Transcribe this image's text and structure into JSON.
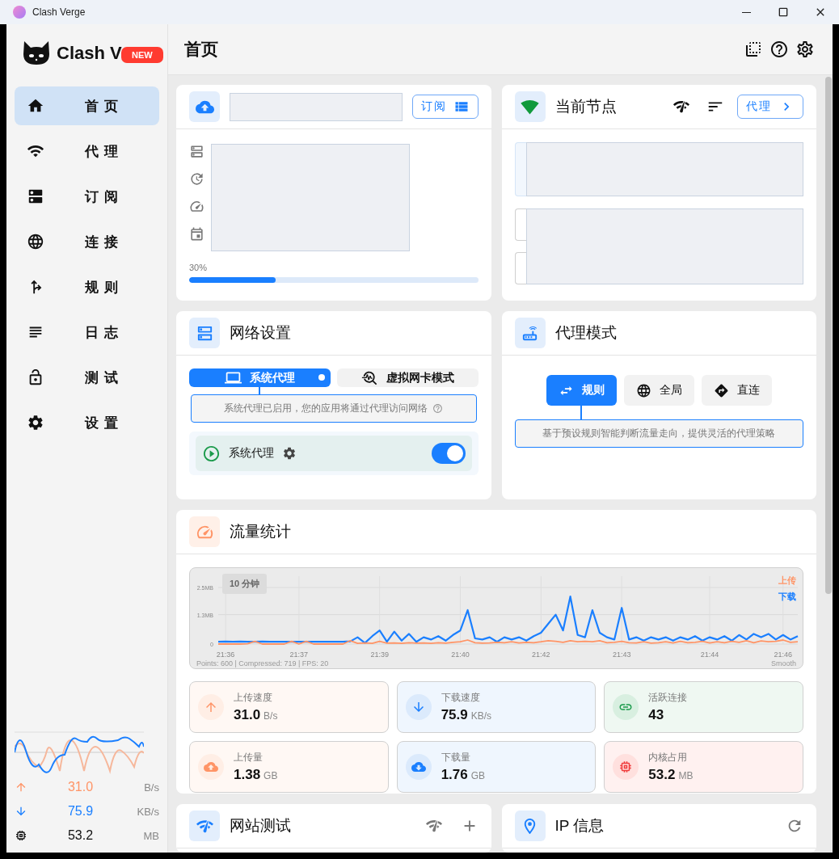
{
  "window": {
    "title": "Clash Verge"
  },
  "sidebar": {
    "brand": "Clash V",
    "badge": "NEW",
    "items": [
      {
        "label": "首 页",
        "selected": true
      },
      {
        "label": "代 理",
        "selected": false
      },
      {
        "label": "订 阅",
        "selected": false
      },
      {
        "label": "连 接",
        "selected": false
      },
      {
        "label": "规 则",
        "selected": false
      },
      {
        "label": "日 志",
        "selected": false
      },
      {
        "label": "测 试",
        "selected": false
      },
      {
        "label": "设 置",
        "selected": false
      }
    ],
    "stats": [
      {
        "kind": "upload",
        "value": "31.0",
        "unit": "B/s"
      },
      {
        "kind": "download",
        "value": "75.9",
        "unit": "KB/s"
      },
      {
        "kind": "memory",
        "value": "53.2",
        "unit": "MB"
      }
    ]
  },
  "header": {
    "title": "首页"
  },
  "profile_card": {
    "button": "订阅",
    "usage": "30%",
    "level": 0.3
  },
  "node_card": {
    "title": "当前节点",
    "button": "代理"
  },
  "network_card": {
    "title": "网络设置",
    "tabs": [
      {
        "label": "系统代理",
        "selected": true
      },
      {
        "label": "虚拟网卡模式",
        "selected": false
      }
    ],
    "hint": "系统代理已启用，您的应用将通过代理访问网络",
    "switch": {
      "label": "系统代理",
      "on": true
    }
  },
  "mode_card": {
    "title": "代理模式",
    "modes": [
      {
        "label": "规则",
        "selected": true
      },
      {
        "label": "全局",
        "selected": false
      },
      {
        "label": "直连",
        "selected": false
      }
    ],
    "hint": "基于预设规则智能判断流量走向，提供灵活的代理策略"
  },
  "traffic_card": {
    "title": "流量统计",
    "range": "10 分钟",
    "footer": "Points: 600 | Compressed: 719 | FPS: 20",
    "smoothing": "Smooth",
    "chart_data": {
      "type": "line",
      "grid": true,
      "ylim": [
        0,
        3
      ],
      "categories": [
        null,
        "21:36",
        null,
        null,
        null,
        null,
        null,
        null,
        null,
        null,
        null,
        "21:37",
        null,
        null,
        null,
        null,
        null,
        null,
        null,
        null,
        null,
        null,
        "21:39",
        null,
        null,
        null,
        null,
        null,
        null,
        null,
        null,
        null,
        null,
        "21:40",
        null,
        null,
        null,
        null,
        null,
        null,
        null,
        null,
        null,
        null,
        "21:42",
        null,
        null,
        null,
        null,
        null,
        null,
        null,
        null,
        null,
        null,
        "21:43",
        null,
        null,
        null,
        null,
        null,
        null,
        null,
        null,
        null,
        null,
        null,
        "21:44",
        null,
        null,
        null,
        null,
        null,
        null,
        null,
        null,
        null,
        "21:46",
        null,
        null
      ],
      "yticks": [
        {
          "value": 0,
          "label": "0"
        },
        {
          "value": 1.3,
          "label": "1.3MB"
        },
        {
          "value": 2.5,
          "label": "2.5MB"
        }
      ],
      "series": [
        {
          "name": "上传",
          "color": "#ff9466",
          "values": [
            0,
            0,
            0,
            0,
            0.01,
            0.12,
            0,
            0,
            0,
            0,
            0.12,
            0,
            0.12,
            0,
            0,
            0,
            0,
            0,
            0.15,
            0.03,
            0.05,
            0.03,
            0.12,
            0.04,
            0.05,
            0.03,
            0.06,
            0.04,
            0.05,
            0.03,
            0.06,
            0.04,
            0.08,
            0.1,
            0.18,
            0.06,
            0.04,
            0.05,
            0.08,
            0.06,
            0.1,
            0.05,
            0.08,
            0.06,
            0.1,
            0.15,
            0.12,
            0.08,
            0.15,
            0.1,
            0.12,
            0.1,
            0.15,
            0.06,
            0.08,
            0.12,
            0.06,
            0.05,
            0.1,
            0.04,
            0.06,
            0.1,
            0.05,
            0.12,
            0.06,
            0.08,
            0.12,
            0.05,
            0.1,
            0.06,
            0.12,
            0.08,
            0.15,
            0.06,
            0.14,
            0.1,
            0.12,
            0.18,
            0.08,
            0.1
          ]
        },
        {
          "name": "下载",
          "color": "#1a7fff",
          "values": [
            0.1,
            0.11,
            0.1,
            0.11,
            0.1,
            0.1,
            0.11,
            0.1,
            0.1,
            0.1,
            0.1,
            0.1,
            0.1,
            0.1,
            0.1,
            0.1,
            0.1,
            0.1,
            0.12,
            0.3,
            0.05,
            0.35,
            0.6,
            0.1,
            0.55,
            0.15,
            0.45,
            0.1,
            0.3,
            0.2,
            0.35,
            0.15,
            0.4,
            0.6,
            1.5,
            0.25,
            0.2,
            0.3,
            0.1,
            0.3,
            0.2,
            0.3,
            0.15,
            0.35,
            0.5,
            0.9,
            1.3,
            0.6,
            2.1,
            0.4,
            0.3,
            1.5,
            0.5,
            0.3,
            0.2,
            1.6,
            0.2,
            0.3,
            0.15,
            0.3,
            0.2,
            0.3,
            0.15,
            0.3,
            0.2,
            0.35,
            0.15,
            0.3,
            0.2,
            0.35,
            0.15,
            0.4,
            0.2,
            0.45,
            0.3,
            0.45,
            0.2,
            0.4,
            0.2,
            0.35
          ]
        }
      ]
    },
    "stats": [
      {
        "kind": "upload_speed",
        "label": "上传速度",
        "value": "31.0",
        "unit": "B/s"
      },
      {
        "kind": "download_speed",
        "label": "下载速度",
        "value": "75.9",
        "unit": "KB/s"
      },
      {
        "kind": "connections",
        "label": "活跃连接",
        "value": "43"
      },
      {
        "kind": "upload_total",
        "label": "上传量",
        "value": "1.38",
        "unit": "GB"
      },
      {
        "kind": "download_total",
        "label": "下载量",
        "value": "1.76",
        "unit": "GB"
      },
      {
        "kind": "memory",
        "label": "内核占用",
        "value": "53.2",
        "unit": "MB"
      }
    ]
  },
  "test_card": {
    "title": "网站测试"
  },
  "ip_card": {
    "title": "IP 信息"
  }
}
